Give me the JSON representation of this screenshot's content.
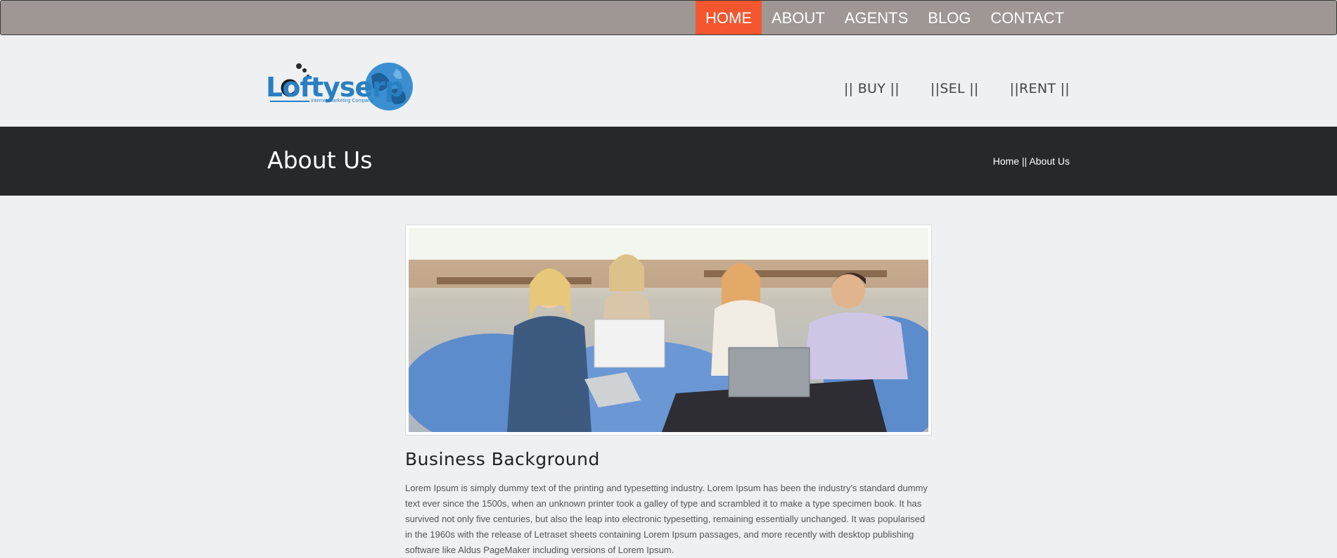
{
  "topnav": {
    "items": [
      {
        "label": "HOME",
        "active": true
      },
      {
        "label": "ABOUT"
      },
      {
        "label": "AGENTS"
      },
      {
        "label": "BLOG"
      },
      {
        "label": "CONTACT"
      }
    ]
  },
  "logo": {
    "brand": "Loftyserp",
    "tagline": "Internet Marketing Company"
  },
  "subnav": {
    "buy": "|| BUY ||",
    "sell": "||SEL ||",
    "rent": "||RENT ||"
  },
  "banner": {
    "title": "About Us",
    "crumb_home": "Home",
    "crumb_sep": "||",
    "crumb_current": "About Us"
  },
  "content": {
    "heading": "Business Background",
    "paragraph": "Lorem Ipsum is simply dummy text of the printing and typesetting industry. Lorem Ipsum has been the industry's standard dummy text ever since the 1500s, when an unknown printer took a galley of type and scrambled it to make a type specimen book. It has survived not only five centuries, but also the leap into electronic typesetting, remaining essentially unchanged. It was popularised in the 1960s with the release of Letraset sheets containing Lorem Ipsum passages, and more recently with desktop publishing software like Aldus PageMaker including versions of Lorem Ipsum."
  },
  "colors": {
    "active_nav": "#f4562f",
    "topbar": "#9e9794",
    "banner": "#272829",
    "logo_blue": "#2a7fc1"
  }
}
